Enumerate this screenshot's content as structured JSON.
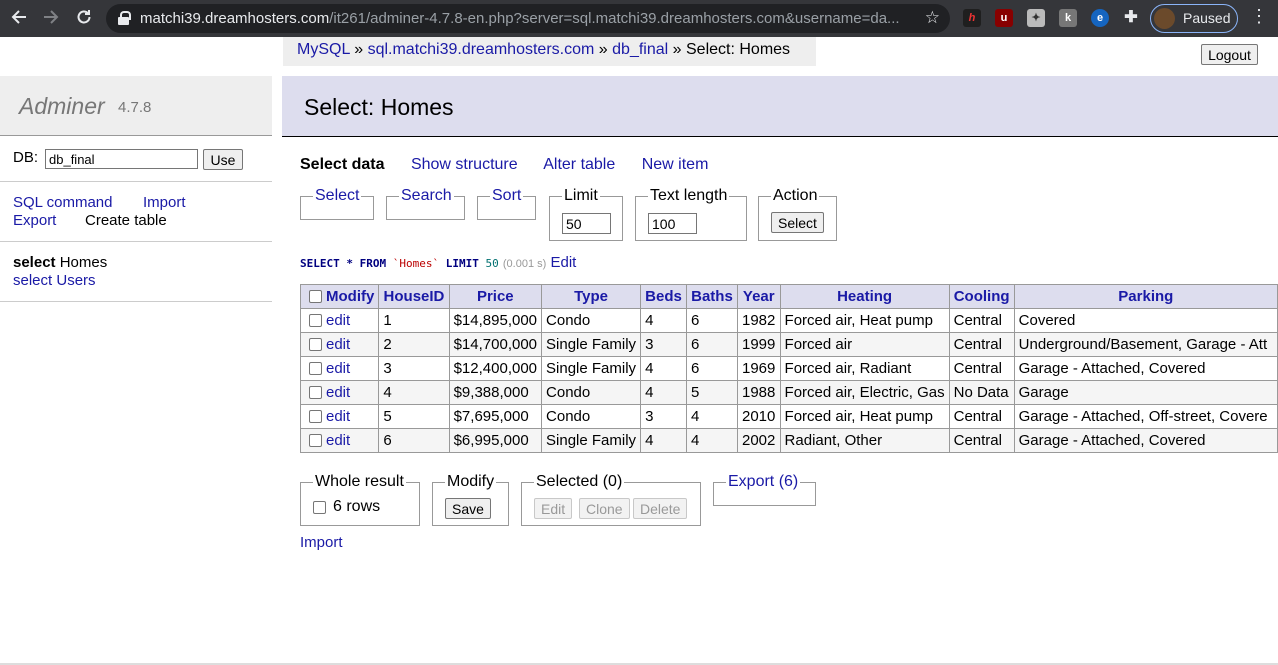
{
  "browser": {
    "url_host": "matchi39.dreamhosters.com",
    "url_path": "/it261/adminer-4.7.8-en.php?server=sql.matchi39.dreamhosters.com&username=da...",
    "profile_status": "Paused",
    "icons": [
      "back-arrow-icon",
      "forward-arrow-icon",
      "reload-icon",
      "lock-icon",
      "star-icon",
      "puzzle-icon",
      "kebab-menu-icon"
    ]
  },
  "breadcrumb": {
    "items": [
      "MySQL",
      "sql.matchi39.dreamhosters.com",
      "db_final"
    ],
    "separator": "»",
    "current": "Select: Homes"
  },
  "logout_label": "Logout",
  "app": {
    "name": "Adminer",
    "version": "4.7.8"
  },
  "db_select": {
    "label": "DB:",
    "value": "db_final",
    "button": "Use"
  },
  "sidebar": {
    "links": [
      "SQL command",
      "Import",
      "Export",
      "Create table"
    ],
    "tables": [
      {
        "action": "select",
        "name": "Homes",
        "active": true
      },
      {
        "action": "select",
        "name": "Users",
        "active": false
      }
    ]
  },
  "page_title": "Select: Homes",
  "tabs": [
    "Select data",
    "Show structure",
    "Alter table",
    "New item"
  ],
  "filters": {
    "select": "Select",
    "search": "Search",
    "sort": "Sort",
    "limit_label": "Limit",
    "limit_value": "50",
    "text_length_label": "Text length",
    "text_length_value": "100",
    "action_label": "Action",
    "action_button": "Select"
  },
  "query": {
    "kw1": "SELECT * FROM",
    "table": "`Homes`",
    "kw2": "LIMIT",
    "limit": "50",
    "time": "(0.001 s)",
    "edit": "Edit"
  },
  "table": {
    "modify_header": "Modify",
    "row_action": "edit",
    "columns": [
      "HouseID",
      "Price",
      "Type",
      "Beds",
      "Baths",
      "Year",
      "Heating",
      "Cooling",
      "Parking"
    ],
    "rows": [
      [
        "1",
        "$14,895,000",
        "Condo",
        "4",
        "6",
        "1982",
        "Forced air, Heat pump",
        "Central",
        "Covered"
      ],
      [
        "2",
        "$14,700,000",
        "Single Family",
        "3",
        "6",
        "1999",
        "Forced air",
        "Central",
        "Underground/Basement, Garage - Att"
      ],
      [
        "3",
        "$12,400,000",
        "Single Family",
        "4",
        "6",
        "1969",
        "Forced air, Radiant",
        "Central",
        "Garage - Attached, Covered"
      ],
      [
        "4",
        "$9,388,000",
        "Condo",
        "4",
        "5",
        "1988",
        "Forced air, Electric, Gas",
        "No Data",
        "Garage"
      ],
      [
        "5",
        "$7,695,000",
        "Condo",
        "3",
        "4",
        "2010",
        "Forced air, Heat pump",
        "Central",
        "Garage - Attached, Off-street, Covere"
      ],
      [
        "6",
        "$6,995,000",
        "Single Family",
        "4",
        "4",
        "2002",
        "Radiant, Other",
        "Central",
        "Garage - Attached, Covered"
      ]
    ]
  },
  "bottom": {
    "whole_result_label": "Whole result",
    "rows_label": "6 rows",
    "modify_label": "Modify",
    "save_button": "Save",
    "selected_label": "Selected (0)",
    "edit_button": "Edit",
    "clone_button": "Clone",
    "delete_button": "Delete",
    "export_label": "Export (6)",
    "import_link": "Import"
  }
}
